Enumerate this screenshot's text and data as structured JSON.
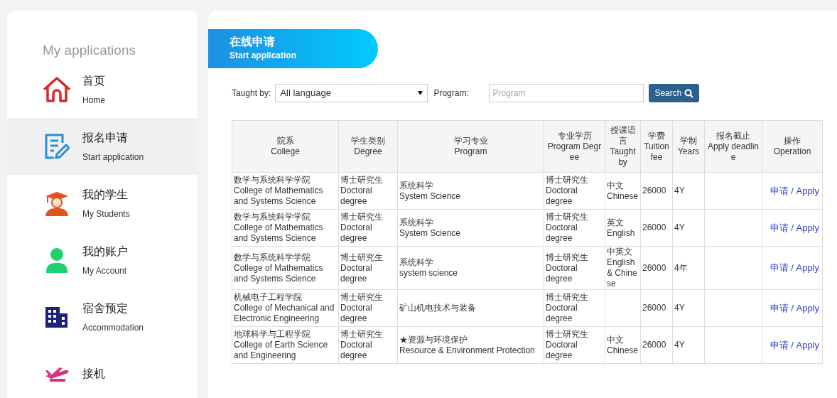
{
  "sidebar": {
    "title": "My applications",
    "items": [
      {
        "kind": "home",
        "zh": "首页",
        "en": "Home",
        "selected": false
      },
      {
        "kind": "apply",
        "zh": "报名申请",
        "en": "Start application",
        "selected": true
      },
      {
        "kind": "students",
        "zh": "我的学生",
        "en": "My Students",
        "selected": false
      },
      {
        "kind": "account",
        "zh": "我的账户",
        "en": "My Account",
        "selected": false
      },
      {
        "kind": "accommodation",
        "zh": "宿舍预定",
        "en": "Accommodation",
        "selected": false
      },
      {
        "kind": "pickup",
        "zh": "接机",
        "selected": false
      }
    ]
  },
  "banner": {
    "zh": "在线申请",
    "en": "Start application"
  },
  "filters": {
    "taught_by_label": "Taught by:",
    "taught_by_value": "All language",
    "program_label": "Program:",
    "program_placeholder": "Program",
    "search_button": "Search"
  },
  "table": {
    "columns": [
      {
        "zh": "院系",
        "en": "College"
      },
      {
        "zh": "学生类别",
        "en": "Degree"
      },
      {
        "zh": "学习专业",
        "en": "Program"
      },
      {
        "zh": "专业学历",
        "en": "Program Degree"
      },
      {
        "zh": "授课语言",
        "en": "Taught by"
      },
      {
        "zh": "学费",
        "en": "Tuition fee"
      },
      {
        "zh": "学制",
        "en": "Years"
      },
      {
        "zh": "报名截止",
        "en": "Apply deadline"
      },
      {
        "zh": "操作",
        "en": "Operation"
      }
    ],
    "rows": [
      {
        "college": [
          "数学与系统科学学院",
          "College of Mathematics and Systems Science"
        ],
        "degree": [
          "博士研究生",
          "Doctoral degree"
        ],
        "program": [
          "系统科学",
          "System Science"
        ],
        "program_degree": [
          "博士研究生",
          "Doctoral degree"
        ],
        "taught_by": [
          "中文",
          "Chinese"
        ],
        "fee": "26000",
        "years": "4Y",
        "action": "申请 / Apply"
      },
      {
        "college": [
          "数学与系统科学学院",
          "College of Mathematics and Systems Science"
        ],
        "degree": [
          "博士研究生",
          "Doctoral degree"
        ],
        "program": [
          "系统科学",
          "System Science"
        ],
        "program_degree": [
          "博士研究生",
          "Doctoral degree"
        ],
        "taught_by": [
          "英文",
          "English"
        ],
        "fee": "26000",
        "years": "4Y",
        "action": "申请 / Apply"
      },
      {
        "college": [
          "数学与系统科学学院",
          "College of Mathematics and Systems Science"
        ],
        "degree": [
          "博士研究生",
          "Doctoral degree"
        ],
        "program": [
          "系统科学",
          "system science"
        ],
        "program_degree": [
          "博士研究生",
          "Doctoral degree"
        ],
        "taught_by": [
          "中英文",
          "English & Chinese"
        ],
        "fee": "26000",
        "years": "4年",
        "action": "申请 / Apply"
      },
      {
        "college": [
          "机械电子工程学院",
          "College of Mechanical and Electronic Engineering"
        ],
        "degree": [
          "博士研究生",
          "Doctoral degree"
        ],
        "program": [
          "矿山机电技术与装备"
        ],
        "program_degree": [
          "博士研究生",
          "Doctoral degree"
        ],
        "taught_by": [],
        "fee": "26000",
        "years": "4Y",
        "action": "申请 / Apply"
      },
      {
        "college": [
          "地球科学与工程学院",
          "College of Earth Science and Engineering"
        ],
        "degree": [
          "博士研究生",
          "Doctoral degree"
        ],
        "program": [
          "★资源与环境保护",
          "Resource & Environment Protection"
        ],
        "program_degree": [
          "博士研究生",
          "Doctoral degree"
        ],
        "taught_by": [
          "中文",
          "Chinese"
        ],
        "fee": "26000",
        "years": "4Y",
        "action": "申请 / Apply"
      }
    ]
  }
}
